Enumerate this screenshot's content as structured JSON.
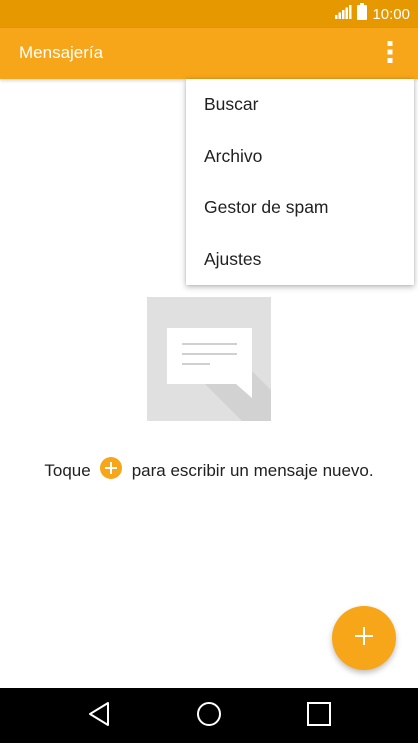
{
  "status_bar": {
    "time": "10:00",
    "icons": [
      "signal-icon",
      "battery-icon"
    ]
  },
  "app_bar": {
    "title": "Mensajería",
    "overflow_icon": "more-vert-icon"
  },
  "overflow_menu": {
    "items": [
      {
        "label": "Buscar"
      },
      {
        "label": "Archivo"
      },
      {
        "label": "Gestor de spam"
      },
      {
        "label": "Ajustes"
      }
    ]
  },
  "empty_state": {
    "illustration": "message-bubble-icon",
    "hint_before": "Toque",
    "hint_icon": "plus-circle-icon",
    "hint_after": "para escribir un mensaje nuevo."
  },
  "fab": {
    "icon": "plus-icon"
  },
  "navigation_bar": {
    "buttons": [
      "back-icon",
      "home-icon",
      "recents-icon"
    ]
  },
  "colors": {
    "status_bar": "#e69800",
    "app_bar": "#f7a519",
    "accent": "#f7a519",
    "illustration_bg": "#e0e0e0",
    "nav_bar": "#000000"
  }
}
